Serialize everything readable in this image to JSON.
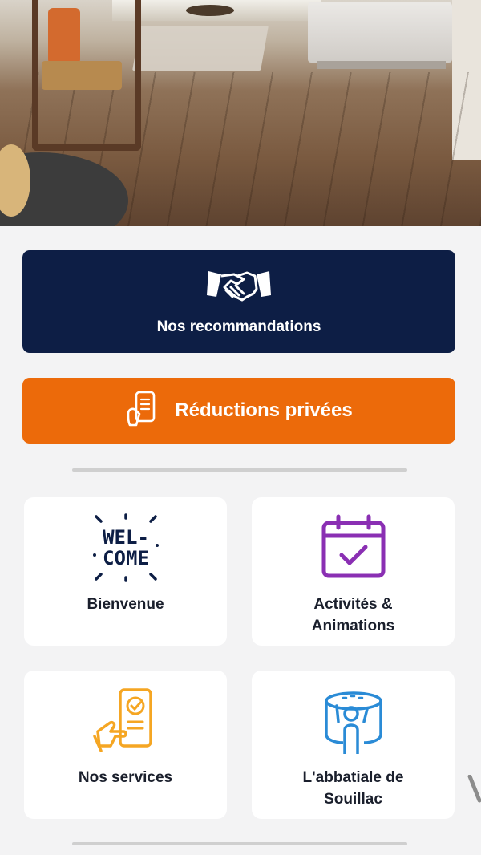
{
  "recommendations": {
    "label": "Nos recommandations",
    "icon": "handshake-icon"
  },
  "discounts": {
    "label": "Réductions privées",
    "icon": "phone-ticket-icon"
  },
  "tiles": [
    {
      "label": "Bienvenue",
      "icon": "welcome-icon",
      "icon_text_1": "WEL-",
      "icon_text_2": "COME"
    },
    {
      "label": "Activités &\nAnimations",
      "icon": "calendar-check-icon"
    },
    {
      "label": "Nos services",
      "icon": "phone-checklist-icon"
    },
    {
      "label": "L'abbatiale de\nSouillac",
      "icon": "virtual-reality-icon"
    }
  ],
  "colors": {
    "navy": "#0d1e45",
    "orange": "#ec6a0a",
    "purple": "#8a2fb3",
    "amber": "#f5a623",
    "blue": "#2a8bd6",
    "background": "#f3f3f4"
  }
}
